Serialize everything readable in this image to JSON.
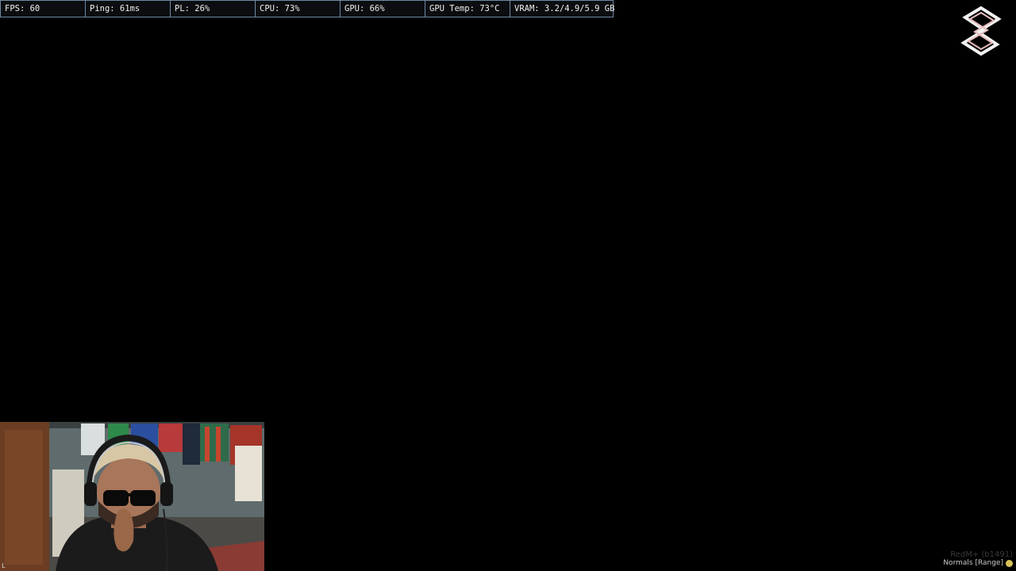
{
  "perf_overlay": {
    "stats": [
      {
        "label": "FPS: 60"
      },
      {
        "label": "Ping: 61ms"
      },
      {
        "label": "PL: 26%"
      },
      {
        "label": "CPU: 73%"
      },
      {
        "label": "GPU: 66%"
      },
      {
        "label": "GPU Temp: 73°C"
      },
      {
        "label": "VRAM: 3.2/4.9/5.9 GB"
      }
    ]
  },
  "logo": {
    "icon": "streamer-s-logo",
    "colors": [
      "#ffffff",
      "#e9c7c7"
    ]
  },
  "webcam": {
    "corner_mark": "L"
  },
  "watermark": {
    "line1": "RedM+ (b1491)",
    "line2": "Normals [Range]"
  }
}
